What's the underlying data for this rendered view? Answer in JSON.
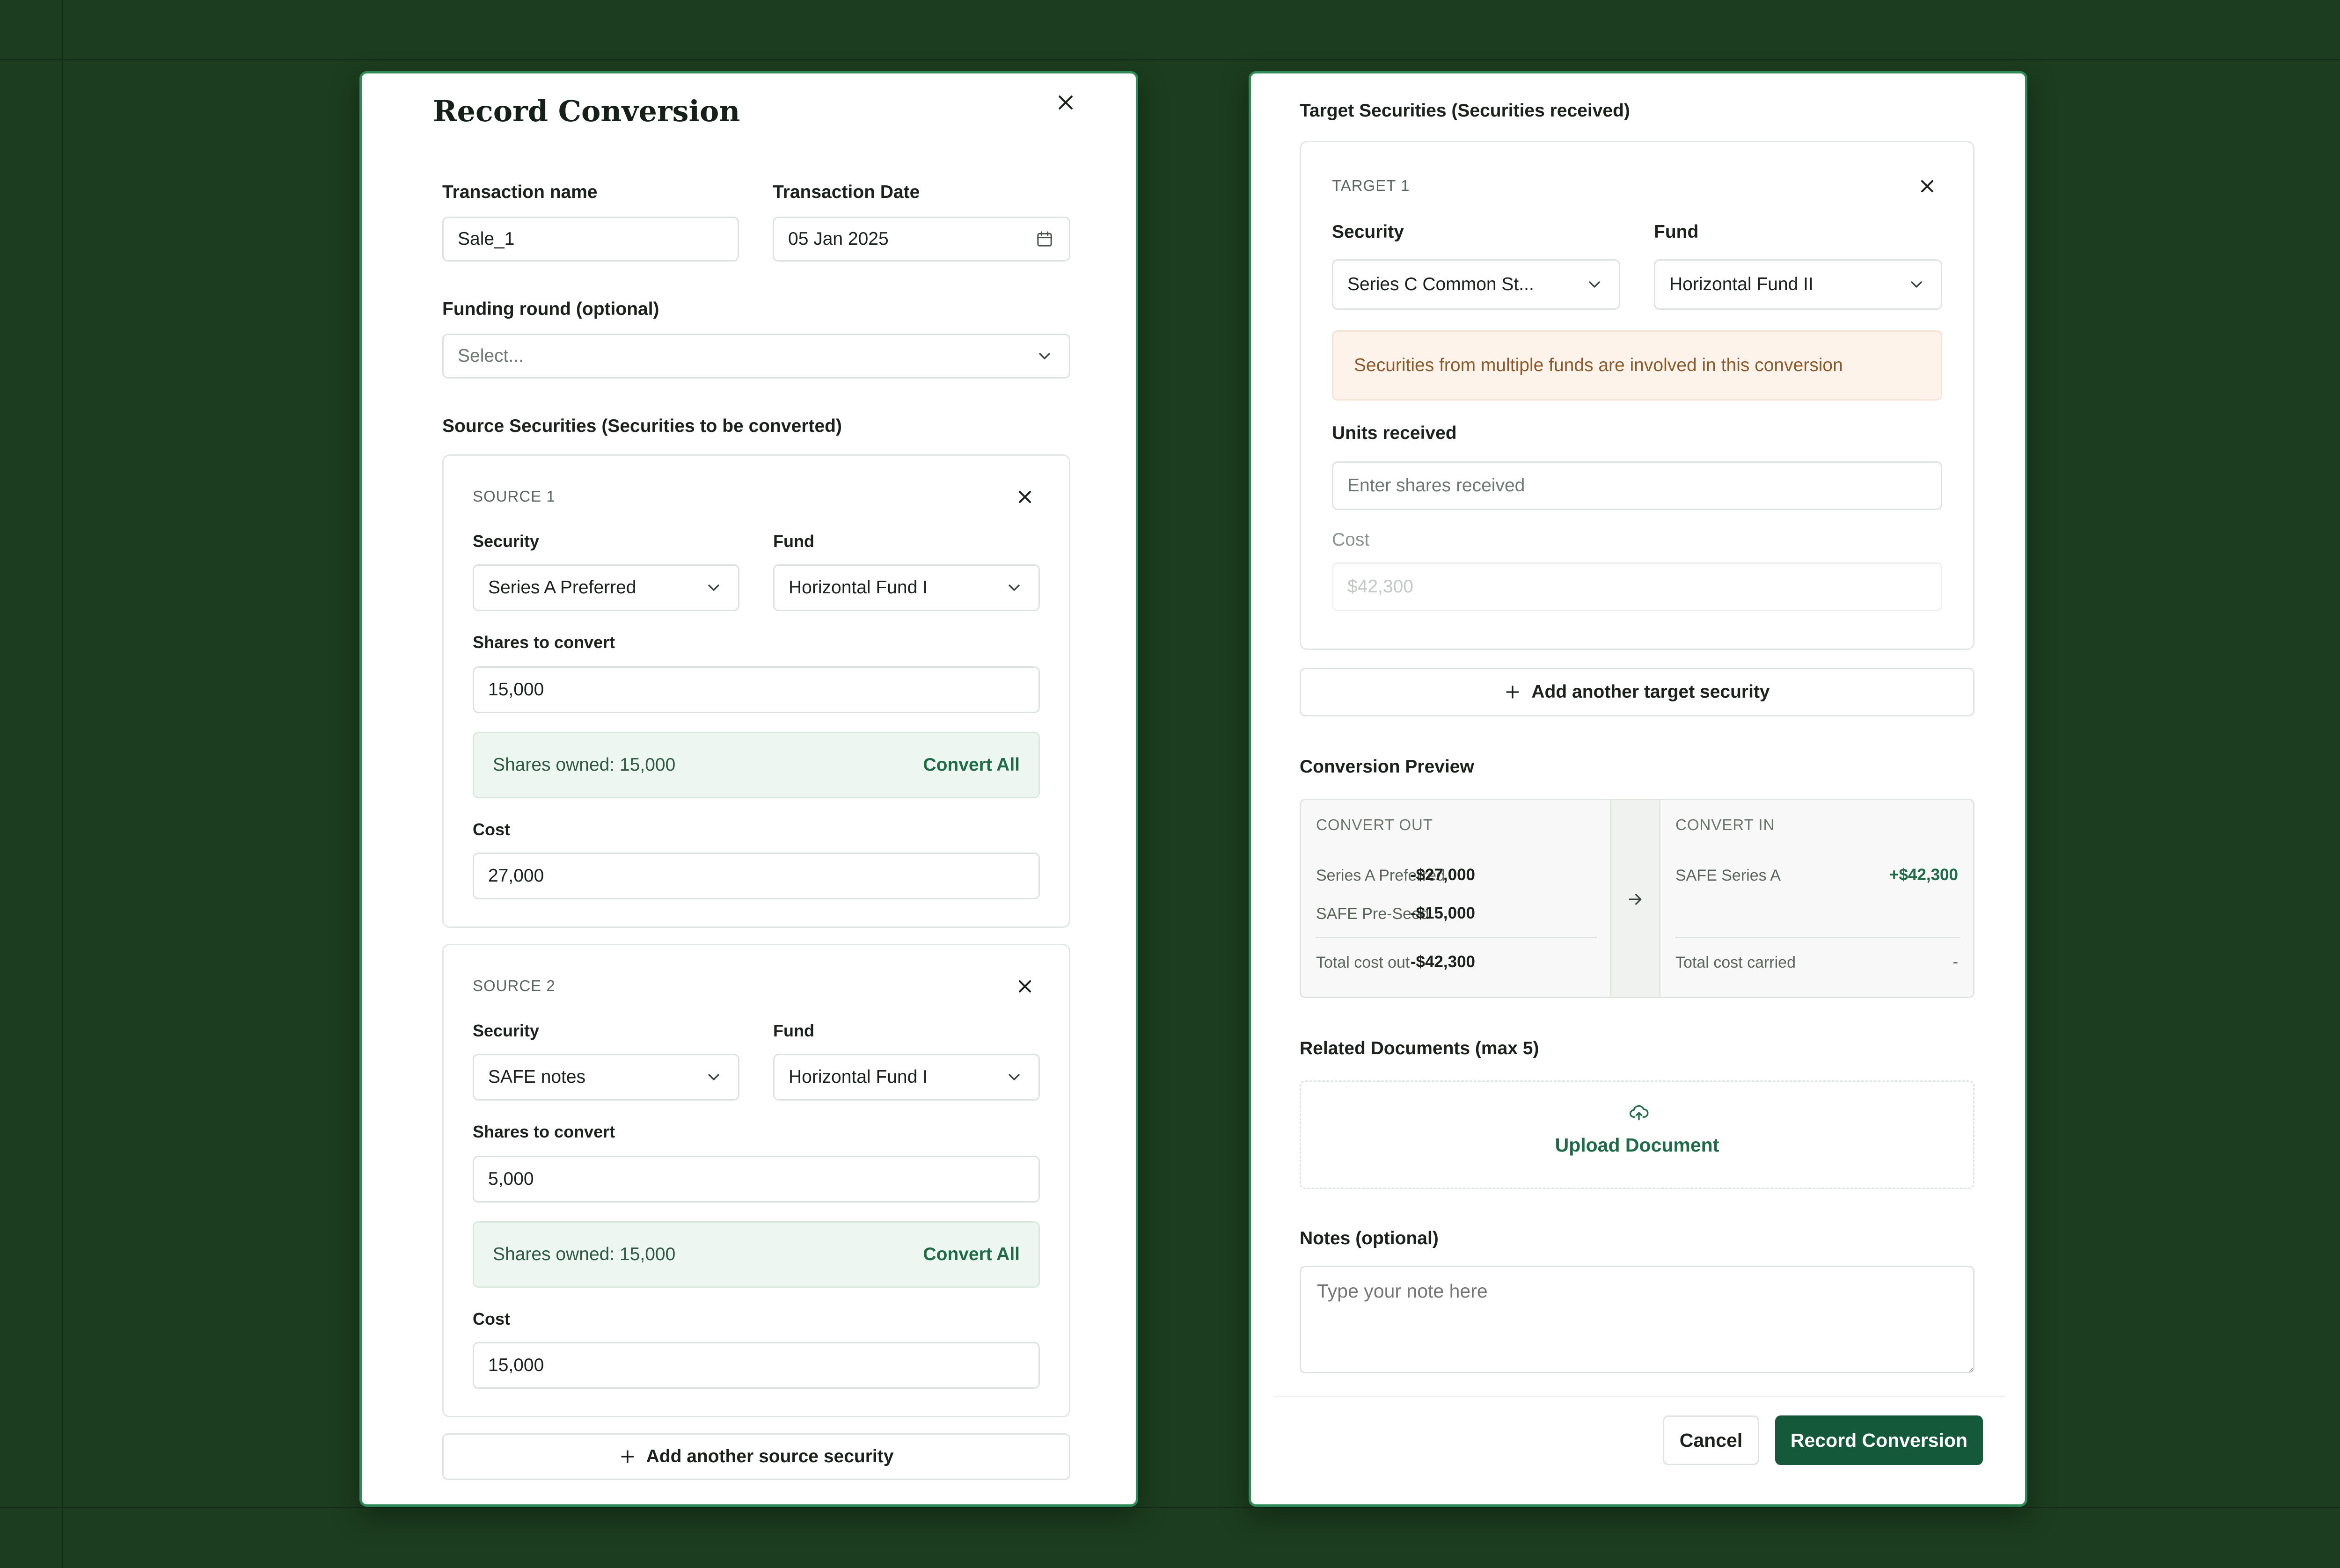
{
  "colors": {
    "background": "#1c3d1f",
    "accent": "#145a3a",
    "accent_text": "#1f6b48",
    "warning_bg": "#fdf3ea",
    "warning_text": "#8a5a2b"
  },
  "modal": {
    "title": "Record Conversion",
    "close_icon": "close-icon",
    "transaction_name": {
      "label": "Transaction name",
      "value": "Sale_1"
    },
    "transaction_date": {
      "label": "Transaction Date",
      "value": "05 Jan 2025",
      "icon": "calendar-icon"
    },
    "funding_round": {
      "label": "Funding round (optional)",
      "placeholder": "Select..."
    },
    "source_section_title": "Source Securities (Securities to be converted)",
    "sources": [
      {
        "tag": "SOURCE 1",
        "security_label": "Security",
        "security": "Series A Preferred",
        "fund_label": "Fund",
        "fund": "Horizontal Fund I",
        "shares_label": "Shares to convert",
        "shares": "15,000",
        "owned": "Shares owned: 15,000",
        "convert_all": "Convert All",
        "cost_label": "Cost",
        "cost": "27,000"
      },
      {
        "tag": "SOURCE 2",
        "security_label": "Security",
        "security": "SAFE notes",
        "fund_label": "Fund",
        "fund": "Horizontal Fund I",
        "shares_label": "Shares to convert",
        "shares": "5,000",
        "owned": "Shares owned: 15,000",
        "convert_all": "Convert All",
        "cost_label": "Cost",
        "cost": "15,000"
      }
    ],
    "add_source": "Add another source security",
    "target_section_title": "Target Securities (Securities received)",
    "targets": [
      {
        "tag": "TARGET 1",
        "security_label": "Security",
        "security": "Series C Common St...",
        "fund_label": "Fund",
        "fund": "Horizontal Fund II",
        "warning": "Securities from multiple funds are involved in this conversion",
        "units_label": "Units received",
        "units_placeholder": "Enter shares received",
        "cost_label": "Cost",
        "cost": "$42,300"
      }
    ],
    "add_target": "Add another target security",
    "preview": {
      "title": "Conversion Preview",
      "out_header": "CONVERT OUT",
      "in_header": "CONVERT IN",
      "out_rows": [
        {
          "name": "Series A Preferred",
          "value": "-$27,000"
        },
        {
          "name": "SAFE Pre-Seed",
          "value": "-$15,000"
        }
      ],
      "out_total_label": "Total cost out",
      "out_total": "-$42,300",
      "in_rows": [
        {
          "name": "SAFE Series A",
          "value": "+$42,300"
        }
      ],
      "in_total_label": "Total cost carried",
      "in_total": "-"
    },
    "documents": {
      "title": "Related Documents (max 5)",
      "upload_label": "Upload Document",
      "icon": "cloud-upload-icon"
    },
    "notes": {
      "label": "Notes (optional)",
      "placeholder": "Type your note here"
    },
    "footer": {
      "cancel": "Cancel",
      "submit": "Record Conversion"
    }
  }
}
